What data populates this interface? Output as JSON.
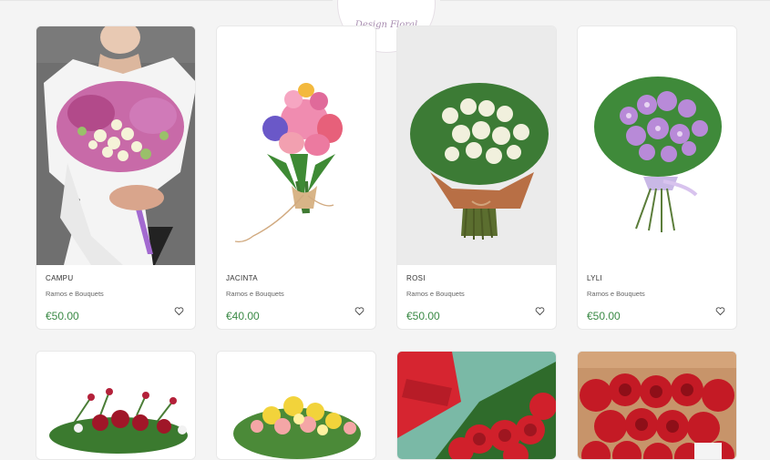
{
  "header": {
    "logo_text": "Design Floral"
  },
  "products": [
    {
      "name": "CAMPU",
      "category": "Ramos e Bouquets",
      "price": "€50.00"
    },
    {
      "name": "JACINTA",
      "category": "Ramos e Bouquets",
      "price": "€40.00"
    },
    {
      "name": "ROSI",
      "category": "Ramos e Bouquets",
      "price": "€50.00"
    },
    {
      "name": "LYLI",
      "category": "Ramos e Bouquets",
      "price": "€50.00"
    }
  ],
  "icons": {
    "wishlist": "heart-outline-icon"
  },
  "colors": {
    "price": "#3b8a46",
    "card_bg": "#ffffff",
    "page_bg": "#f4f4f4"
  }
}
